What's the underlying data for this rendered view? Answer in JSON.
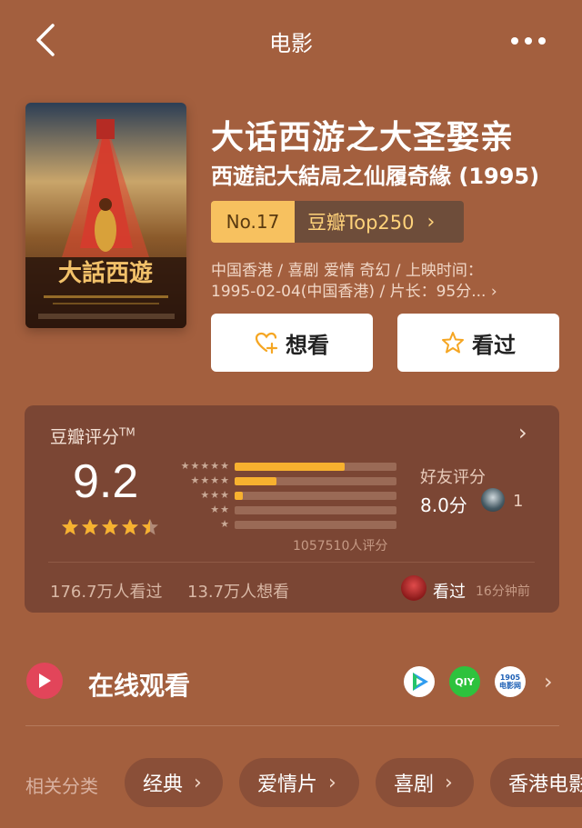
{
  "nav": {
    "title": "电影"
  },
  "movie": {
    "title_cn": "大话西游之大圣娶亲",
    "title_orig": "西遊記大結局之仙履奇緣 (1995)",
    "rank_no": "No.17",
    "rank_list": "豆瓣Top250",
    "meta_line1": "中国香港 / 喜剧 爱情 奇幻 / 上映时间：",
    "meta_line2": "1995-02-04(中国香港) / 片长：95分...",
    "poster_title": "大話西遊"
  },
  "actions": {
    "want_label": "想看",
    "seen_label": "看过"
  },
  "rating": {
    "title": "豆瓣评分",
    "tm": "TM",
    "score": "9.2",
    "stars": 4.5,
    "distribution": [
      0.68,
      0.26,
      0.05,
      0.0,
      0.0
    ],
    "votes_text": "1057510人评分",
    "friend_label": "好友评分",
    "friend_score": "8.0分",
    "friend_count": "1",
    "seen_count": "176.7万人看过",
    "want_count": "13.7万人想看",
    "recent_action": "看过",
    "recent_time": "16分钟前"
  },
  "online": {
    "title": "在线观看",
    "platforms": [
      "tencent-video-icon",
      "iqiyi-icon",
      "1905-movie-icon"
    ],
    "platform3_label": "1905\n电影网"
  },
  "related": {
    "label": "相关分类",
    "tags": [
      "经典",
      "爱情片",
      "喜剧",
      "香港电影"
    ]
  },
  "colors": {
    "background": "#a35f3e",
    "card": "#7b4634",
    "accent": "#f7b12f",
    "rank_bg": "#f7c15f"
  }
}
